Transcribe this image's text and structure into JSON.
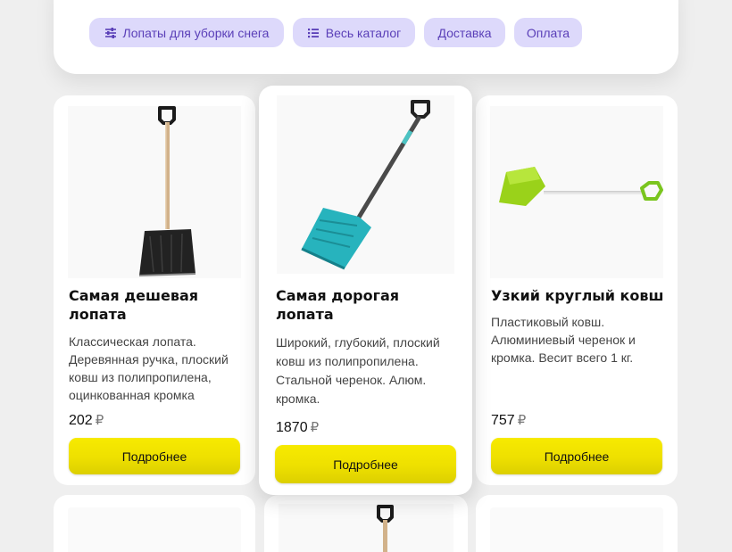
{
  "filters": {
    "shovels": "Лопаты для уборки снега",
    "catalog": "Весь каталог",
    "delivery": "Доставка",
    "payment": "Оплата"
  },
  "products": [
    {
      "title": "Самая дешевая лопата",
      "description": "Классическая лопата. Деревянная ручка, плоский ковш из полипропилена, оцинкованная кромка",
      "price": "202",
      "currency": "₽",
      "button": "Подробнее"
    },
    {
      "title": "Самая дорогая лопата",
      "description": "Широкий, глубокий, плоский ковш из полипропилена. Стальной черенок. Алюм. кромка.",
      "price": "1870",
      "currency": "₽",
      "button": "Подробнее"
    },
    {
      "title": "Узкий круглый ковш",
      "description": "Пластиковый ковш. Алюминиевый черенок и кромка. Весит всего 1 кг.",
      "price": "757",
      "currency": "₽",
      "button": "Подробнее"
    }
  ]
}
